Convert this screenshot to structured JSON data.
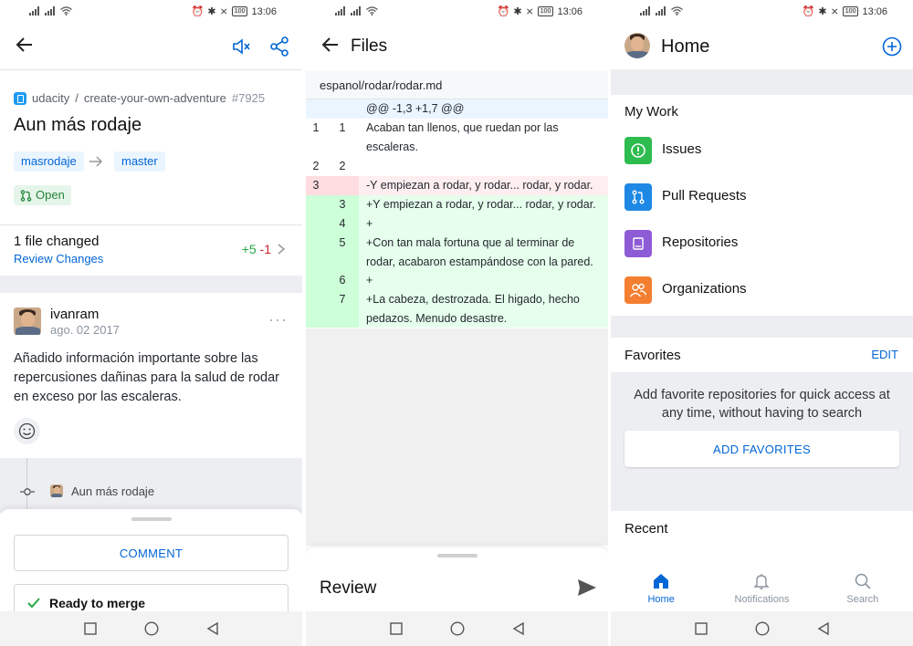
{
  "status_bar": {
    "time": "13:06",
    "battery": "100"
  },
  "pr_screen": {
    "repo_owner": "udacity",
    "repo_separator": " / ",
    "repo_name": "create-your-own-adventure",
    "pr_number": "#7925",
    "title": "Aun más rodaje",
    "head_branch": "masrodaje",
    "base_branch": "master",
    "state": "Open",
    "files_changed": "1 file changed",
    "review_changes": "Review Changes",
    "additions": "+5",
    "deletions": "-1",
    "comment": {
      "author": "ivanram",
      "date": "ago. 02 2017",
      "body": "Añadido información importante sobre las repercusiones dañinas para la salud de rodar en exceso por las escaleras."
    },
    "timeline_label": "Aun más rodaje",
    "comment_button": "COMMENT",
    "merge_status": "Ready to merge"
  },
  "files_screen": {
    "title": "Files",
    "file_path": "espanol/rodar/rodar.md",
    "diff": [
      {
        "old": "",
        "new": "",
        "text": "@@ -1,3 +1,7 @@",
        "kind": "hunk"
      },
      {
        "old": "1",
        "new": "1",
        "text": "Acaban tan llenos, que ruedan por las escaleras.",
        "kind": "context"
      },
      {
        "old": "2",
        "new": "2",
        "text": "",
        "kind": "context"
      },
      {
        "old": "3",
        "new": "",
        "text": "-Y empiezan a rodar, y rodar... rodar, y rodar.",
        "kind": "del"
      },
      {
        "old": "",
        "new": "3",
        "text": "+Y empiezan a rodar, y rodar... rodar, y rodar.",
        "kind": "add"
      },
      {
        "old": "",
        "new": "4",
        "text": "+",
        "kind": "add"
      },
      {
        "old": "",
        "new": "5",
        "text": "+Con tan mala fortuna que al terminar de rodar, acabaron estampándose con la pared.",
        "kind": "add"
      },
      {
        "old": "",
        "new": "6",
        "text": "+",
        "kind": "add"
      },
      {
        "old": "",
        "new": "7",
        "text": "+La cabeza, destrozada. El higado, hecho pedazos. Menudo desastre.",
        "kind": "add"
      }
    ],
    "review_label": "Review"
  },
  "home_screen": {
    "title": "Home",
    "my_work_header": "My Work",
    "work_items": [
      {
        "label": "Issues",
        "icon": "issue-icon",
        "color": "#2ebc4f"
      },
      {
        "label": "Pull Requests",
        "icon": "pull-request-icon",
        "color": "#1e88e5"
      },
      {
        "label": "Repositories",
        "icon": "repo-icon",
        "color": "#8e5bd6"
      },
      {
        "label": "Organizations",
        "icon": "organization-icon",
        "color": "#f57f31"
      }
    ],
    "favorites_header": "Favorites",
    "favorites_edit": "EDIT",
    "favorites_empty": "Add favorite repositories for quick access at any time, without having to search",
    "add_favorites": "ADD FAVORITES",
    "recent_header": "Recent",
    "tabs": [
      {
        "label": "Home",
        "icon": "home-icon",
        "active": true
      },
      {
        "label": "Notifications",
        "icon": "bell-icon",
        "active": false
      },
      {
        "label": "Search",
        "icon": "search-icon",
        "active": false
      }
    ]
  },
  "colors": {
    "accent": "#0366d6",
    "add_bg": "#e6ffed",
    "del_bg": "#ffeef0",
    "hunk_bg": "#eaf5ff"
  }
}
